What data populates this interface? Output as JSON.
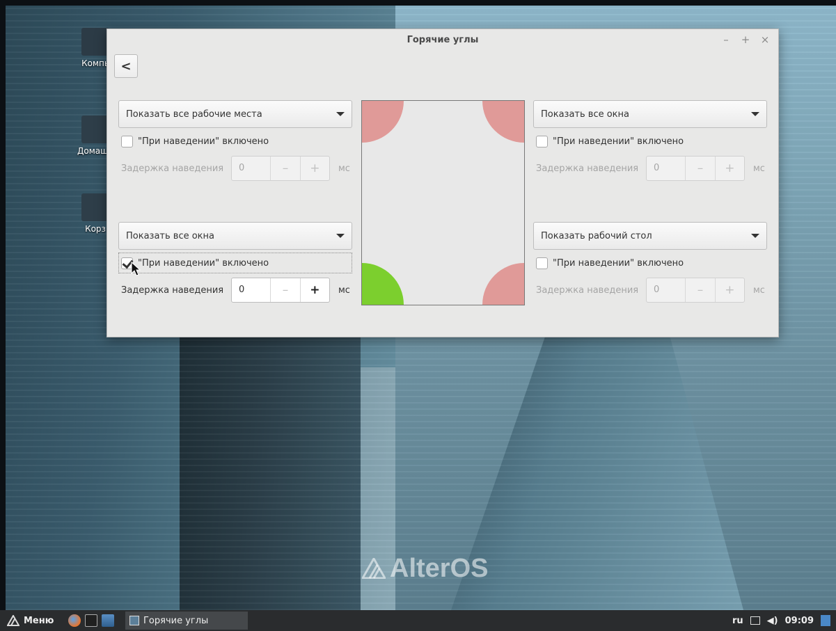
{
  "desktop": {
    "icons": [
      {
        "label": "Компь",
        "color": "#2c3b46"
      },
      {
        "label": "Домашн",
        "color": "#2e3e49"
      },
      {
        "label": "Корз",
        "color": "#2e3e49"
      }
    ],
    "logo_text": "AlterOS"
  },
  "window": {
    "title": "Горячие углы",
    "controls": {
      "minimize": "–",
      "maximize": "+",
      "close": "×"
    },
    "back_label": "<"
  },
  "corners": {
    "top_left": {
      "action": "Показать все рабочие места",
      "hover_label": "\"При наведении\" включено",
      "hover_checked": false,
      "delay_label": "Задержка наведения",
      "delay_value": "0",
      "minus": "–",
      "plus": "+",
      "unit": "мс"
    },
    "top_right": {
      "action": "Показать все окна",
      "hover_label": "\"При наведении\" включено",
      "hover_checked": false,
      "delay_label": "Задержка наведения",
      "delay_value": "0",
      "minus": "–",
      "plus": "+",
      "unit": "мс"
    },
    "bottom_left": {
      "action": "Показать все окна",
      "hover_label": "\"При наведении\" включено",
      "hover_checked": true,
      "delay_label": "Задержка наведения",
      "delay_value": "0",
      "minus": "–",
      "plus": "+",
      "unit": "мс"
    },
    "bottom_right": {
      "action": "Показать рабочий стол",
      "hover_label": "\"При наведении\" включено",
      "hover_checked": false,
      "delay_label": "Задержка наведения",
      "delay_value": "0",
      "minus": "–",
      "plus": "+",
      "unit": "мс"
    }
  },
  "preview": {
    "colors": {
      "inactive": "#e09a98",
      "active": "#7ccf2e"
    }
  },
  "taskbar": {
    "menu_label": "Меню",
    "task_label": "Горячие углы",
    "lang": "ru",
    "volume_icon": "◀)",
    "time": "09:09"
  }
}
